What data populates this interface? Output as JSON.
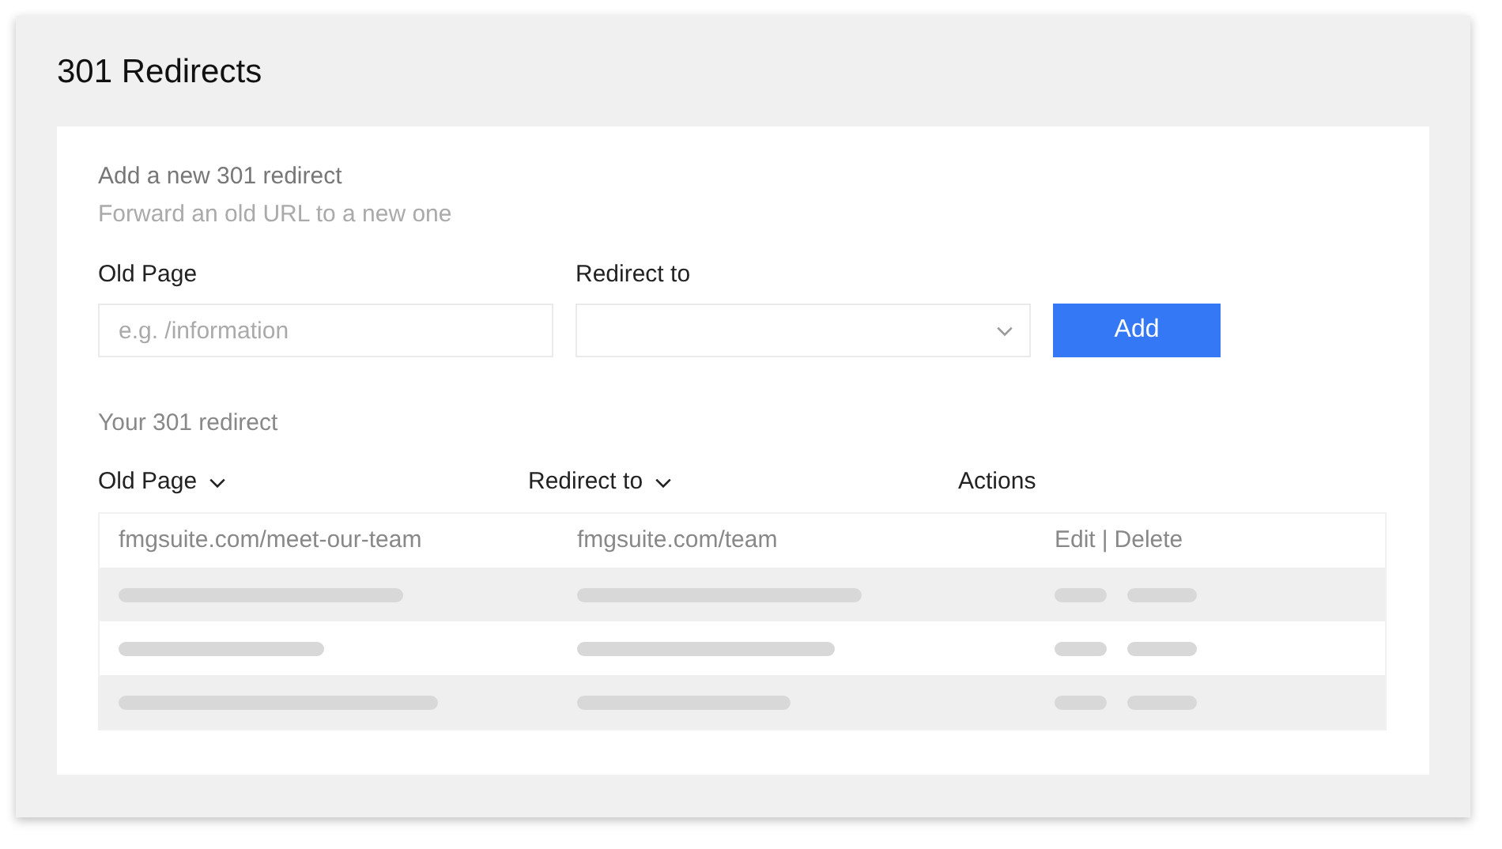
{
  "title": "301 Redirects",
  "form": {
    "heading": "Add a new 301 redirect",
    "subheading": "Forward an old URL to a new one",
    "old_page": {
      "label": "Old Page",
      "placeholder": "e.g. /information"
    },
    "redirect_to": {
      "label": "Redirect to"
    },
    "add_button": "Add"
  },
  "list": {
    "heading": "Your 301 redirect",
    "columns": [
      {
        "label": "Old Page",
        "sortable": true
      },
      {
        "label": "Redirect to",
        "sortable": true
      },
      {
        "label": "Actions",
        "sortable": false
      }
    ],
    "rows": [
      {
        "kind": "entry",
        "old_page": "fmgsuite.com/meet-our-team",
        "redirect_to": "fmgsuite.com/team",
        "actions": [
          "Edit",
          "Delete"
        ],
        "separator": "|"
      },
      {
        "kind": "skeleton"
      },
      {
        "kind": "skeleton"
      },
      {
        "kind": "skeleton"
      }
    ]
  }
}
